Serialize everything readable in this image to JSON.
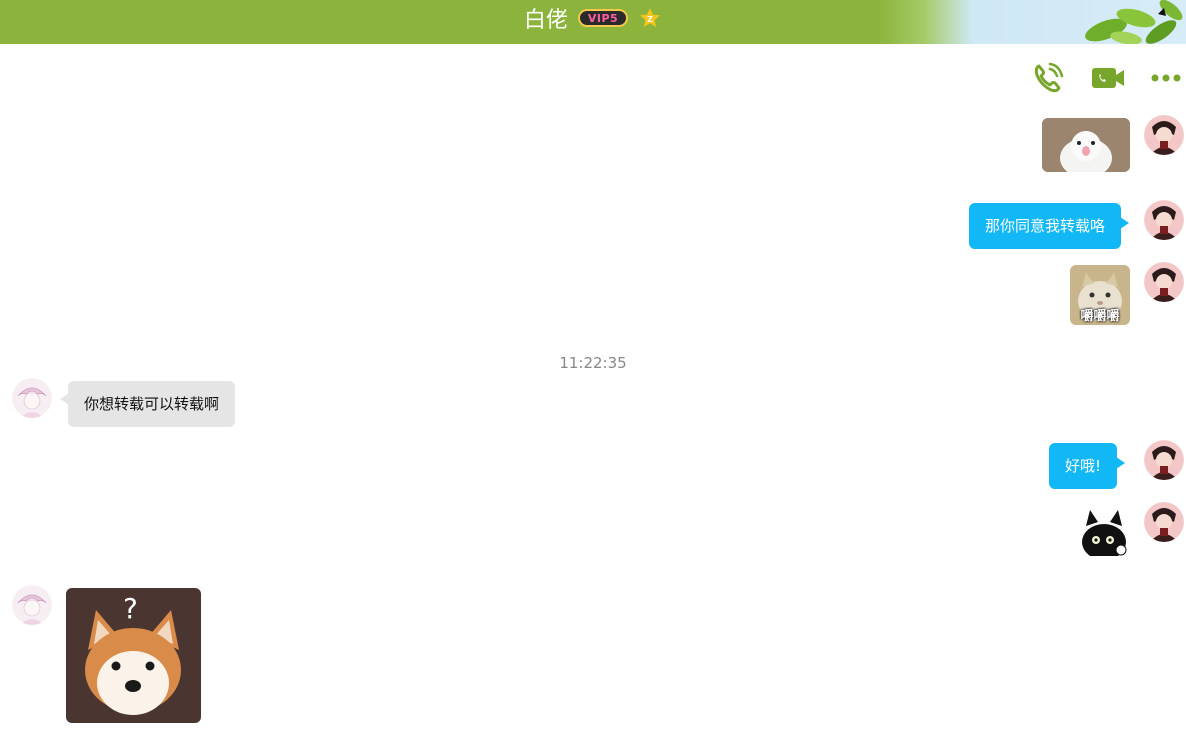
{
  "header": {
    "title": "白佬",
    "vip_badge": "VIP5",
    "star_badge": "Z",
    "bg_color": "#8cb43c"
  },
  "toolbar": {
    "icons": [
      "voice-call-icon",
      "video-call-icon",
      "more-icon"
    ],
    "icon_color": "#78a62c"
  },
  "messages": {
    "m1": {
      "sender": "me",
      "type": "sticker",
      "sticker": "white-bird"
    },
    "m2": {
      "sender": "me",
      "type": "text",
      "text": "那你同意我转载咯"
    },
    "m3": {
      "sender": "me",
      "type": "sticker",
      "sticker": "cat-chewing",
      "caption": "嚼嚼嚼"
    },
    "timestamp": "11:22:35",
    "m4": {
      "sender": "other",
      "type": "text",
      "text": "你想转载可以转载啊"
    },
    "m5": {
      "sender": "me",
      "type": "text",
      "text": "好哦!"
    },
    "m6": {
      "sender": "me",
      "type": "sticker",
      "sticker": "black-cat-thumbs-up"
    },
    "m7": {
      "sender": "other",
      "type": "sticker",
      "sticker": "shiba-question",
      "caption": "?"
    }
  },
  "colors": {
    "my_bubble": "#12b7f5",
    "other_bubble": "#e5e5e5"
  }
}
